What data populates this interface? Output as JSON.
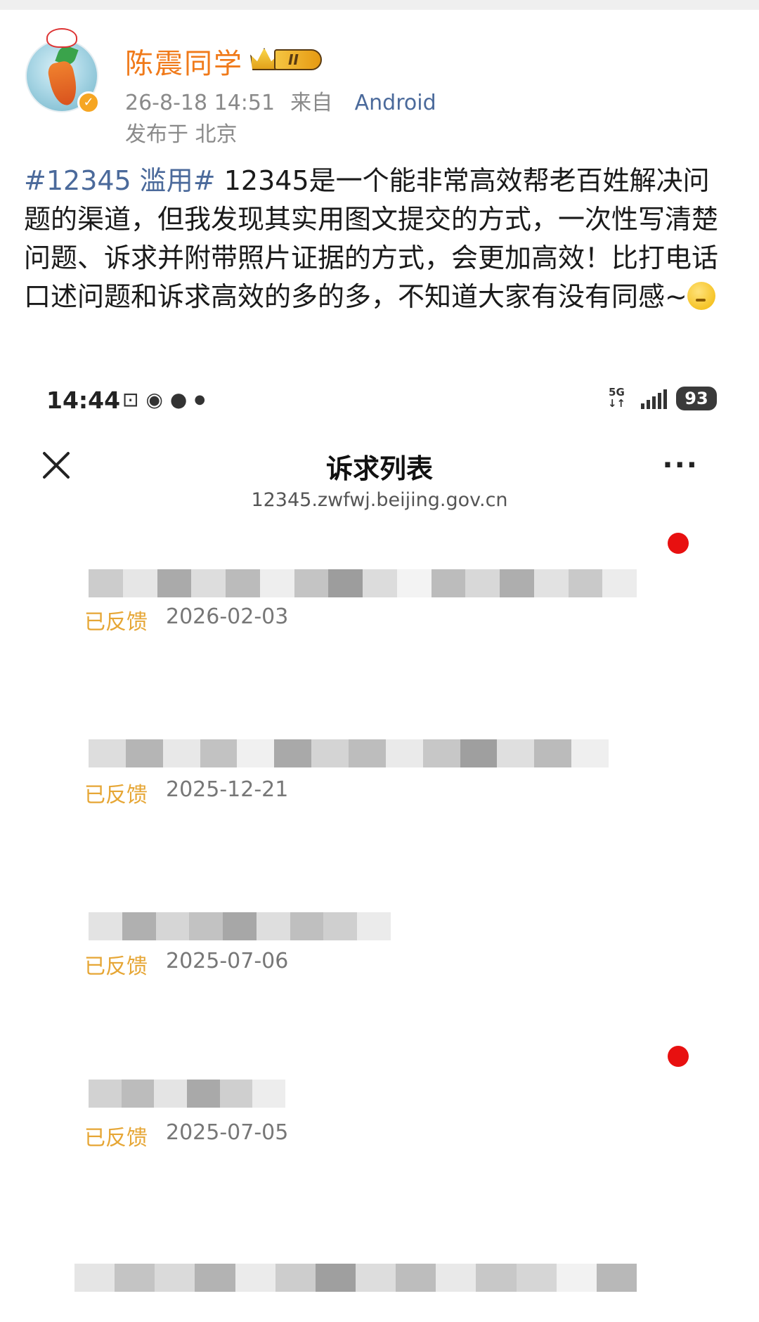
{
  "post": {
    "username": "陈震同学",
    "level": "II",
    "timestamp": "26-8-18 14:51",
    "from_label": "来自",
    "source": "Android",
    "location": "发布于 北京",
    "topic": "#12345 滥用#",
    "body": " 12345是一个能非常高效帮老百姓解决问题的渠道，但我发现其实用图文提交的方式，一次性写清楚问题、诉求并附带照片证据的方式，会更加高效！比打电话口述问题和诉求高效的多的多，不知道大家有没有同感~",
    "emoji": "thinking-face-emoji"
  },
  "screenshot": {
    "status_bar": {
      "time": "14:44",
      "icons": [
        "screenshot-icon",
        "wechat-icon",
        "message-icon",
        "dot-icon"
      ],
      "network": "5G",
      "battery": "93"
    },
    "header": {
      "title": "诉求列表",
      "url": "12345.zwfwj.beijing.gov.cn",
      "close_icon": "close-icon",
      "more_icon": "more-icon"
    },
    "items": [
      {
        "status": "已反馈",
        "date": "2026-02-03",
        "unread": true
      },
      {
        "status": "已反馈",
        "date": "2025-12-21",
        "unread": false
      },
      {
        "status": "已反馈",
        "date": "2025-07-06",
        "unread": false
      },
      {
        "status": "已反馈",
        "date": "2025-07-05",
        "unread": true
      }
    ]
  },
  "colors": {
    "username": "#f07a1a",
    "topic_link": "#4b6a9b",
    "status": "#e6a635",
    "unread_dot": "#e81010"
  }
}
